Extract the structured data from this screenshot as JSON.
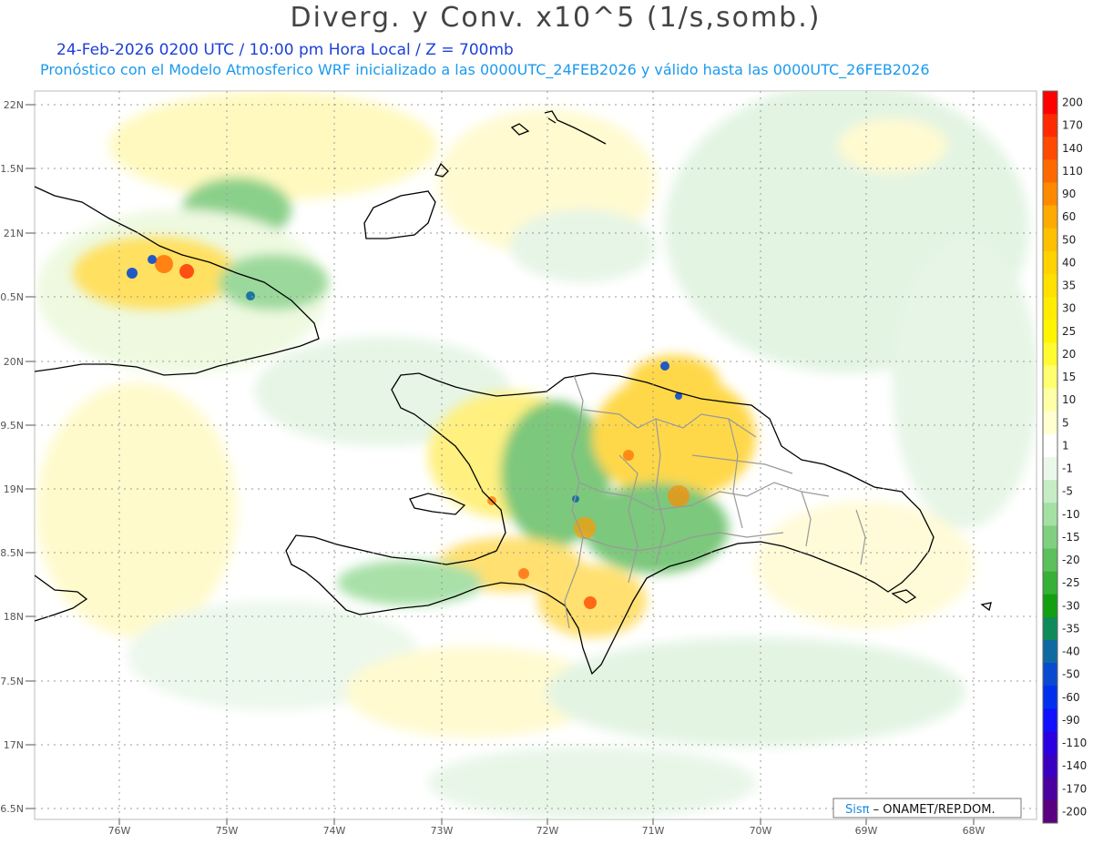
{
  "title": "Diverg. y Conv. x10^5 (1/s,somb.)",
  "subtitle_1": "24-Feb-2026  0200 UTC / 10:00 pm Hora Local / Z = 700mb",
  "subtitle_2": "Pronóstico con el Modelo Atmosferico WRF inicializado a las 0000UTC_24FEB2026 y válido hasta las  0000UTC_26FEB2026",
  "lat_labels": [
    "22N",
    "1.5N",
    "21N",
    "0.5N",
    "20N",
    "9.5N",
    "19N",
    "8.5N",
    "18N",
    "7.5N",
    "17N",
    "6.5N"
  ],
  "lon_labels": [
    "76W",
    "75W",
    "74W",
    "73W",
    "72W",
    "71W",
    "70W",
    "69W",
    "68W"
  ],
  "credit": {
    "brand": "Sisπ",
    "text": " – ONAMET/REP.DOM."
  },
  "colorbar": [
    {
      "label": "200",
      "color": "#ff0000"
    },
    {
      "label": "170",
      "color": "#ff2a00"
    },
    {
      "label": "140",
      "color": "#ff4a00"
    },
    {
      "label": "110",
      "color": "#ff6a00"
    },
    {
      "label": "90",
      "color": "#ff8a00"
    },
    {
      "label": "60",
      "color": "#ffaa00"
    },
    {
      "label": "50",
      "color": "#ffc000"
    },
    {
      "label": "40",
      "color": "#ffd200"
    },
    {
      "label": "35",
      "color": "#ffe000"
    },
    {
      "label": "30",
      "color": "#ffec00"
    },
    {
      "label": "25",
      "color": "#fff500"
    },
    {
      "label": "20",
      "color": "#fffb30"
    },
    {
      "label": "15",
      "color": "#ffff70"
    },
    {
      "label": "10",
      "color": "#ffffa8"
    },
    {
      "label": "5",
      "color": "#ffffd0"
    },
    {
      "label": "1",
      "color": "#ffffff"
    },
    {
      "label": "-1",
      "color": "#eaf8ea"
    },
    {
      "label": "-5",
      "color": "#c6ecc6"
    },
    {
      "label": "-10",
      "color": "#a4e0a4"
    },
    {
      "label": "-15",
      "color": "#80d080"
    },
    {
      "label": "-20",
      "color": "#5cc05c"
    },
    {
      "label": "-25",
      "color": "#36b036"
    },
    {
      "label": "-30",
      "color": "#12a012"
    },
    {
      "label": "-35",
      "color": "#108a5a"
    },
    {
      "label": "-40",
      "color": "#0e6aa0"
    },
    {
      "label": "-50",
      "color": "#0a4ad0"
    },
    {
      "label": "-60",
      "color": "#0030ee"
    },
    {
      "label": "-90",
      "color": "#1010ff"
    },
    {
      "label": "-110",
      "color": "#2a00e0"
    },
    {
      "label": "-140",
      "color": "#3a00c0"
    },
    {
      "label": "-170",
      "color": "#4a009e"
    },
    {
      "label": "-200",
      "color": "#5a0080"
    }
  ]
}
